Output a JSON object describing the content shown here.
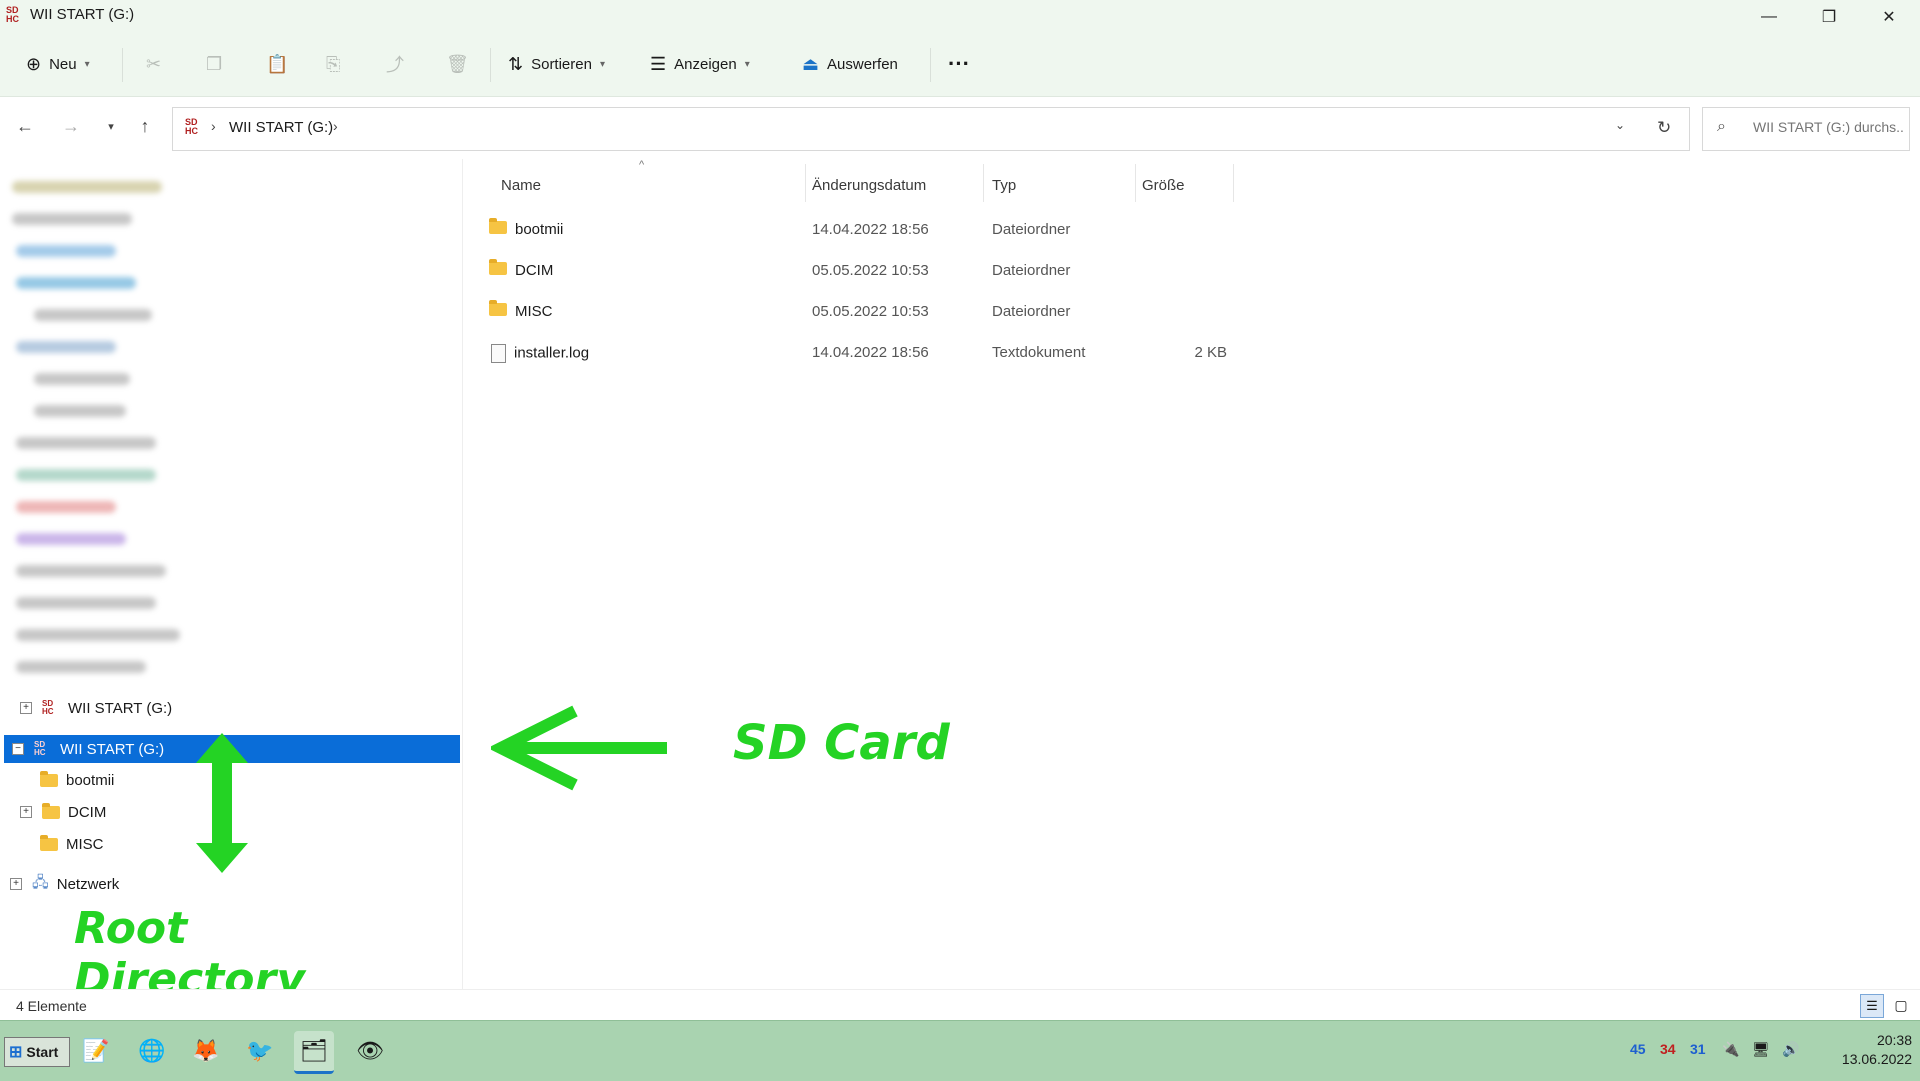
{
  "window": {
    "title": "WII START (G:)",
    "drive_icon_text": "SD\nHC",
    "minimize_glyph": "—",
    "maximize_glyph": "❐",
    "close_glyph": "✕"
  },
  "ribbon": {
    "new_label": "Neu",
    "sort_label": "Sortieren",
    "view_label": "Anzeigen",
    "eject_label": "Auswerfen",
    "more_label": "···"
  },
  "address": {
    "crumb": "WII START (G:)",
    "search_placeholder": "WII START (G:) durchs..."
  },
  "file_columns": {
    "name": "Name",
    "date": "Änderungsdatum",
    "type": "Typ",
    "size": "Größe"
  },
  "files": [
    {
      "name": "bootmii",
      "date": "14.04.2022 18:56",
      "type": "Dateiordner",
      "size": "",
      "kind": "folder"
    },
    {
      "name": "DCIM",
      "date": "05.05.2022 10:53",
      "type": "Dateiordner",
      "size": "",
      "kind": "folder"
    },
    {
      "name": "MISC",
      "date": "05.05.2022 10:53",
      "type": "Dateiordner",
      "size": "",
      "kind": "folder"
    },
    {
      "name": "installer.log",
      "date": "14.04.2022 18:56",
      "type": "Textdokument",
      "size": "2 KB",
      "kind": "file"
    }
  ],
  "navpane": {
    "drive1_label": "WII START (G:)",
    "drive2_label": "WII START (G:)",
    "children": [
      "bootmii",
      "DCIM",
      "MISC"
    ],
    "network_label": "Netzwerk"
  },
  "annotations": {
    "sd_card": "SD Card",
    "root_dir": "Root Directory",
    "color": "#24d324"
  },
  "status": {
    "count": "4 Elemente"
  },
  "taskbar": {
    "start_label": "Start",
    "tray_nums": [
      "45",
      "34",
      "31"
    ],
    "time": "20:38",
    "date": "13.06.2022"
  }
}
